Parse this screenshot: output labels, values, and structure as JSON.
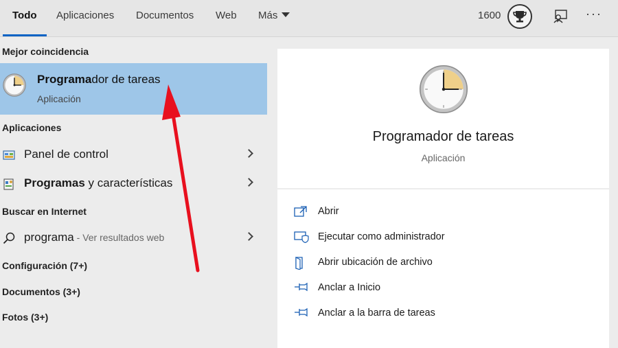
{
  "tabs": {
    "todo": "Todo",
    "apps": "Aplicaciones",
    "docs": "Documentos",
    "web": "Web",
    "more": "Más"
  },
  "header": {
    "points": "1600",
    "more_dots": "···",
    "icons": [
      "trophy-icon",
      "feedback-icon",
      "more-options-icon"
    ]
  },
  "best_match": {
    "heading": "Mejor coincidencia",
    "title_bold": "Programa",
    "title_rest": "dor de tareas",
    "subtitle": "Aplicación",
    "icon": "clock-icon"
  },
  "apps_section": {
    "heading": "Aplicaciones",
    "items": [
      {
        "label": "Panel de control",
        "icon": "control-panel-icon"
      },
      {
        "label_bold": "Programas",
        "label_rest": " y características",
        "icon": "programs-features-icon"
      }
    ]
  },
  "web_section": {
    "heading": "Buscar en Internet",
    "query": "programa",
    "hint": " - Ver resultados web",
    "icon": "search-icon"
  },
  "categories": {
    "settings": "Configuración (7+)",
    "documents": "Documentos (3+)",
    "photos": "Fotos (3+)"
  },
  "details": {
    "app_name": "Programador de tareas",
    "app_type": "Aplicación",
    "actions": [
      {
        "label": "Abrir",
        "icon": "open-icon"
      },
      {
        "label": "Ejecutar como administrador",
        "icon": "run-as-admin-icon"
      },
      {
        "label": "Abrir ubicación de archivo",
        "icon": "file-location-icon"
      },
      {
        "label": "Anclar a Inicio",
        "icon": "pin-icon"
      },
      {
        "label": "Anclar a la barra de tareas",
        "icon": "pin-icon"
      }
    ]
  },
  "colors": {
    "accent": "#0a63c4",
    "selected_row": "#9ec6e8",
    "arrow": "#e8101e"
  }
}
